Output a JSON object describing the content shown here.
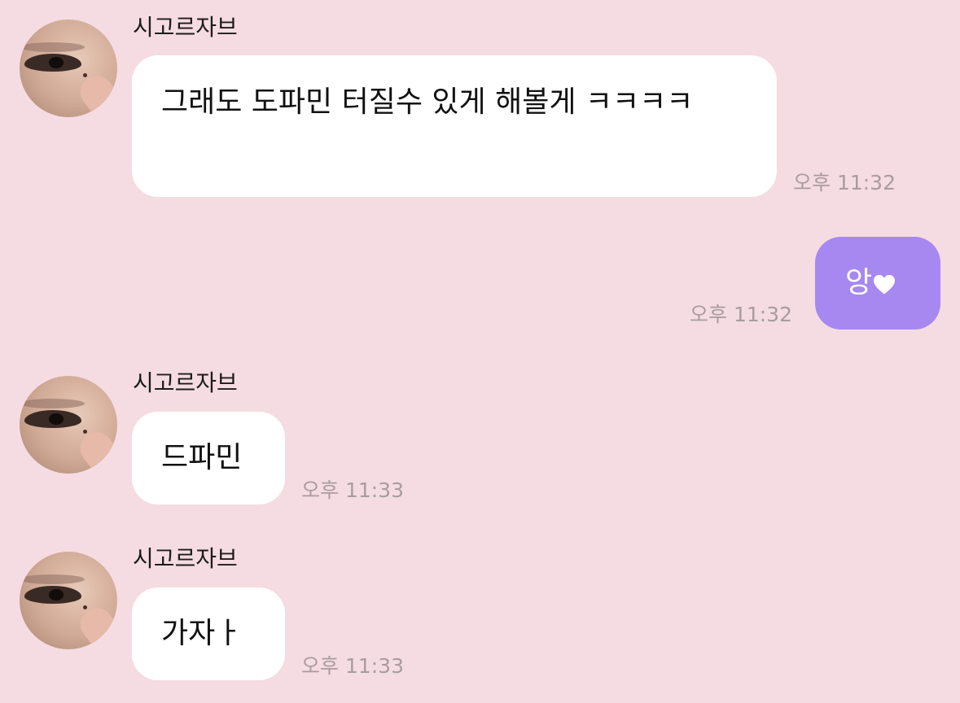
{
  "messages": [
    {
      "sender": "시고르자브",
      "text": "그래도 도파민 터질수 있게 해볼게 ㅋㅋㅋㅋ",
      "time": "오후 11:32",
      "direction": "incoming"
    },
    {
      "text": "앙",
      "emoji": "white-heart-icon",
      "time": "오후 11:32",
      "direction": "outgoing"
    },
    {
      "sender": "시고르자브",
      "text": "드파민",
      "time": "오후 11:33",
      "direction": "incoming"
    },
    {
      "sender": "시고르자브",
      "text": "가자ㅏ",
      "time": "오후 11:33",
      "direction": "incoming"
    }
  ],
  "colors": {
    "background": "#f5dce2",
    "incoming_bubble": "#ffffff",
    "outgoing_bubble": "#a688f0",
    "timestamp": "#a99ca0"
  }
}
